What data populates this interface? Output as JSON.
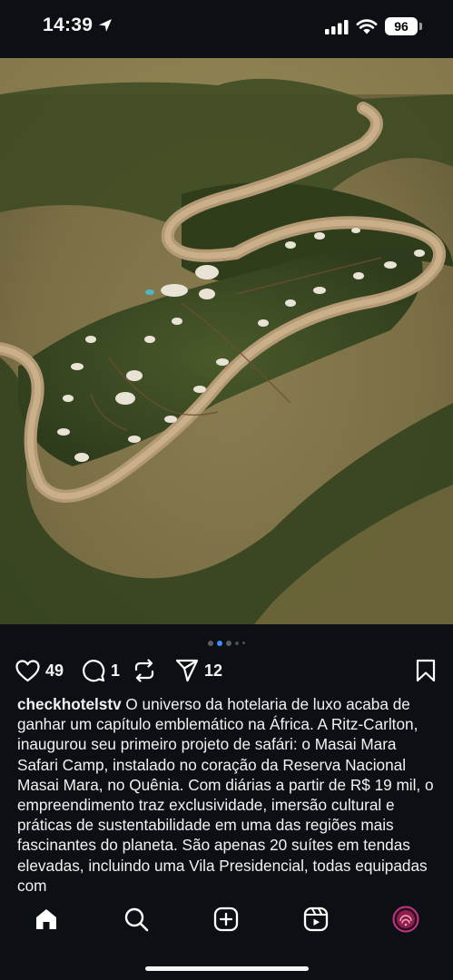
{
  "status": {
    "time": "14:39",
    "battery": "96"
  },
  "post": {
    "dots": 5,
    "active_dot": 1,
    "likes": "49",
    "comments": "1",
    "shares": "12",
    "username": "checkhotelstv",
    "caption": " O universo da hotelaria de luxo acaba de ganhar um capítulo emblemático na África. A Ritz-Carlton,  inaugurou seu primeiro projeto de safári: o Masai Mara Safari Camp, instalado no coração da Reserva Nacional Masai Mara, no Quênia. Com diárias a partir de R$ 19 mil, o empreendimento traz exclusividade, imersão cultural e práticas de sustentabilidade em uma das regiões mais fascinantes do planeta. São apenas 20 suítes em tendas elevadas, incluindo uma Vila Presidencial, todas equipadas com"
  },
  "icons": {
    "location": "location-arrow-icon",
    "like": "heart-icon",
    "comment": "comment-bubble-icon",
    "repost": "repost-icon",
    "share": "paper-plane-icon",
    "save": "bookmark-icon",
    "nav": [
      "home-icon",
      "search-icon",
      "create-icon",
      "reels-icon",
      "profile-avatar"
    ]
  },
  "colors": {
    "background": "#0c1014",
    "active_dot": "#3d8ff5",
    "text": "#f5f5f5",
    "avatar_ring": "#c13584"
  }
}
